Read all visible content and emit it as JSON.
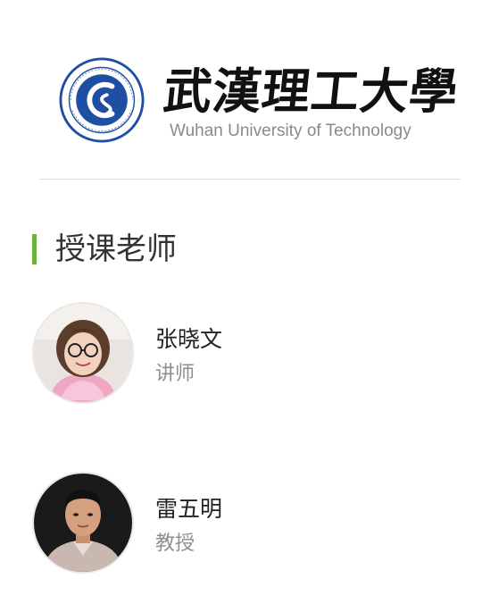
{
  "header": {
    "logo_alt": "Wuhan University of Technology emblem",
    "name_cn": "武漢理工大學",
    "name_en": "Wuhan University of Technology",
    "brand_blue": "#1f4fa3"
  },
  "section": {
    "title": "授课老师",
    "accent": "#6cb33e"
  },
  "teachers": [
    {
      "name": "张晓文",
      "title": "讲师",
      "avatar_icon": "teacher-photo-female"
    },
    {
      "name": "雷五明",
      "title": "教授",
      "avatar_icon": "teacher-photo-male"
    }
  ]
}
